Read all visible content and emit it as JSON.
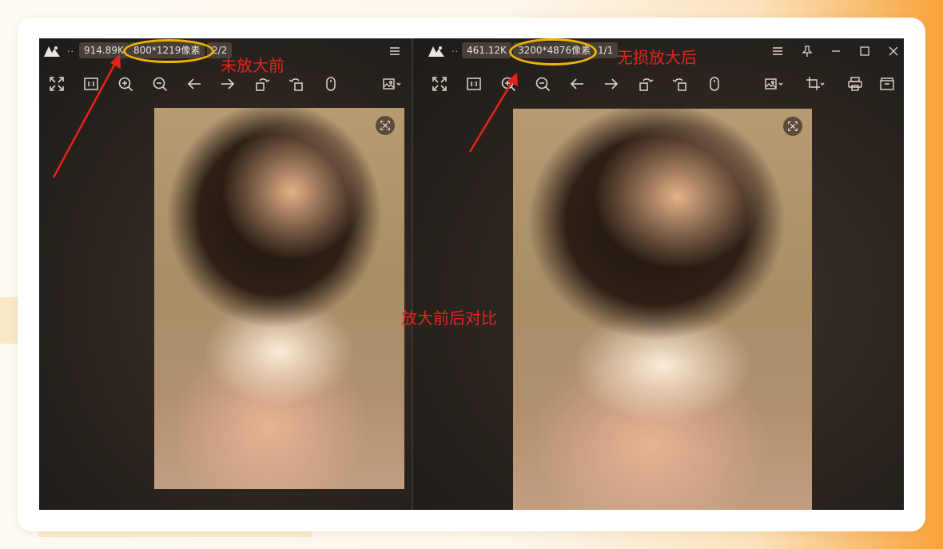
{
  "left_viewer": {
    "file_size": "914.89K",
    "dimensions": "800*1219像素",
    "page_counter": "2/2"
  },
  "right_viewer": {
    "file_size": "461.12K",
    "dimensions": "3200*4876像素",
    "page_counter": "1/1"
  },
  "title_dots": "..",
  "annotations": {
    "before": "未放大前",
    "after": "无损放大后",
    "compare": "放大前后对比"
  },
  "toolbar_icons": [
    "fullscreen-icon",
    "actual-size-icon",
    "zoom-in-icon",
    "zoom-out-icon",
    "previous-icon",
    "next-icon",
    "rotate-left-icon",
    "rotate-right-icon",
    "mouse-icon",
    "image-options-icon",
    "crop-icon",
    "print-icon",
    "folder-icon"
  ],
  "window_icons": [
    "menu-icon",
    "pin-icon",
    "minimize-icon",
    "maximize-icon",
    "close-icon"
  ],
  "colors": {
    "annotation": "#e8221b",
    "highlight_ring": "#f0b400",
    "viewer_bg": "#2b241f"
  }
}
